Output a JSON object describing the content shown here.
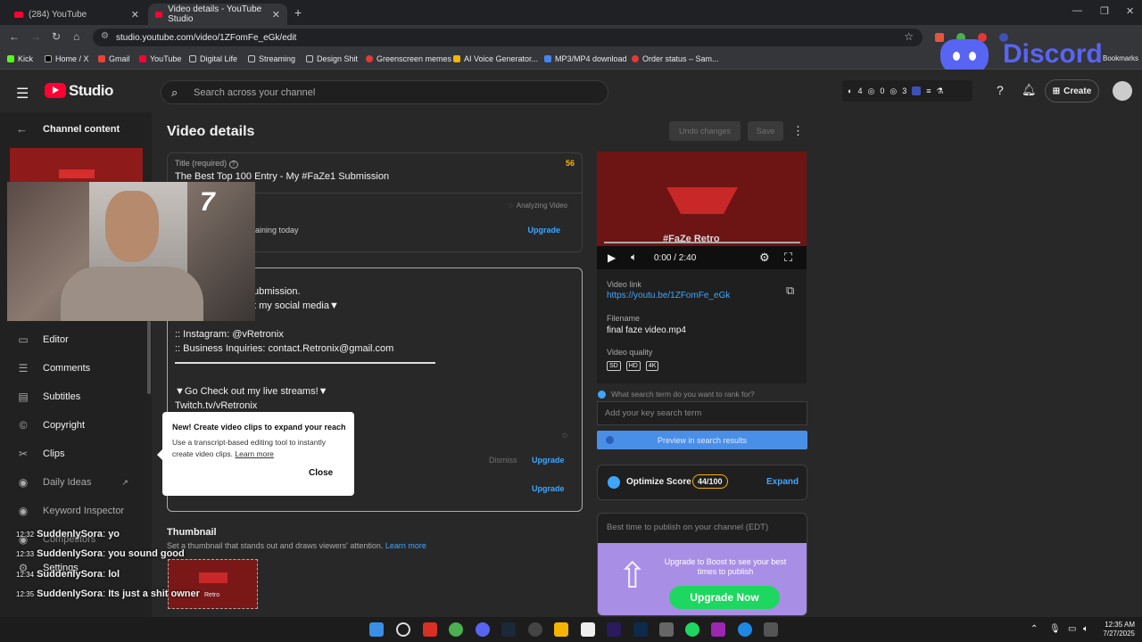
{
  "browser": {
    "tabs": [
      {
        "label": "(284) YouTube"
      },
      {
        "label": "Video details - YouTube Studio"
      }
    ],
    "url": "studio.youtube.com/video/1ZFomFe_eGk/edit",
    "bookmarks": [
      "Kick",
      "Home / X",
      "Gmail",
      "YouTube",
      "Digital Life",
      "Streaming",
      "Design Shit",
      "Greenscreen memes",
      "AI Voice Generator...",
      "MP3/MP4 download",
      "Order status – Sam..."
    ],
    "bookmarks_extra": "Bookmarks"
  },
  "overlay": {
    "discord_logo": "Discord",
    "webcam_number": "7"
  },
  "studio": {
    "logo": "Studio",
    "search_placeholder": "Search across your channel",
    "stats": [
      "4",
      "0",
      "3"
    ],
    "create_label": "Create"
  },
  "sidebar": {
    "back_label": "Channel content",
    "items": [
      {
        "label": "Editor",
        "icon": "editor-icon"
      },
      {
        "label": "Comments",
        "icon": "comments-icon"
      },
      {
        "label": "Subtitles",
        "icon": "subtitles-icon"
      },
      {
        "label": "Copyright",
        "icon": "copyright-icon"
      },
      {
        "label": "Clips",
        "icon": "clips-icon"
      },
      {
        "label": "Daily Ideas",
        "icon": "tubebuddy-icon"
      },
      {
        "label": "Keyword Inspector",
        "icon": "tubebuddy-icon"
      },
      {
        "label": "Competitors",
        "icon": "tubebuddy-icon"
      },
      {
        "label": "Settings",
        "icon": "gear-icon"
      }
    ]
  },
  "main": {
    "page_title": "Video details",
    "undo_label": "Undo changes",
    "save_label": "Save",
    "title_field": {
      "label": "Title (required)",
      "count": "56",
      "value": "The Best Top 100 Entry - My #FaZe1 Submission"
    },
    "analyzing": "Analyzing Video",
    "remaining_text": "aining today",
    "upgrade": "Upgrade",
    "description_lines": [
      "ubmission.",
      "t my social media▼",
      ":: Instagram: @vRetronix",
      ":: Business Inquiries: contact.Retronix@gmail.com",
      "▼Go Check out my live streams!▼",
      "Twitch.tv/vRetronix"
    ],
    "dismiss": "Dismiss",
    "popup": {
      "title": "New! Create video clips to expand your reach",
      "body": "Use a transcript-based editing tool to instantly create video clips.",
      "learn_more": "Learn more",
      "close": "Close"
    },
    "thumbnail": {
      "title": "Thumbnail",
      "desc": "Set a thumbnail that stands out and draws viewers' attention.",
      "learn_more": "Learn more"
    }
  },
  "right": {
    "video_overlay": "#FaZe Retro",
    "thumb_brand": "Retro",
    "time": "0:00 / 2:40",
    "video_link_label": "Video link",
    "video_link": "https://youtu.be/1ZFomFe_eGk",
    "filename_label": "Filename",
    "filename": "final faze video.mp4",
    "quality_label": "Video quality",
    "qualities": [
      "SD",
      "HD",
      "4K"
    ],
    "rank_question": "What search term do you want to rank for?",
    "keyword_placeholder": "Add your key search term",
    "preview_btn": "Preview in search results",
    "optimize_label": "Optimize Score",
    "optimize_score": "44/100",
    "expand": "Expand",
    "best_time": "Best time to publish on your channel (EDT)",
    "boost_text": "Upgrade to Boost to see your best times to publish",
    "boost_bold": "Boost",
    "upgrade_now": "Upgrade Now"
  },
  "chat": [
    {
      "time": "12:32",
      "user": "SuddenlySora",
      "msg": "yo"
    },
    {
      "time": "12:33",
      "user": "SuddenlySora",
      "msg": "you sound good"
    },
    {
      "time": "12:34",
      "user": "SuddenlySora",
      "msg": "lol"
    },
    {
      "time": "12:35",
      "user": "SuddenlySora",
      "msg": "Its just a shit owner"
    }
  ],
  "taskbar": {
    "time": "12:35 AM",
    "date": "7/27/2025"
  },
  "colors": {
    "accent": "#3ea6ff",
    "youtube_red": "#ff0033",
    "boost_purple": "#a98ee6",
    "upgrade_green": "#1ed760",
    "discord": "#5865f2"
  }
}
